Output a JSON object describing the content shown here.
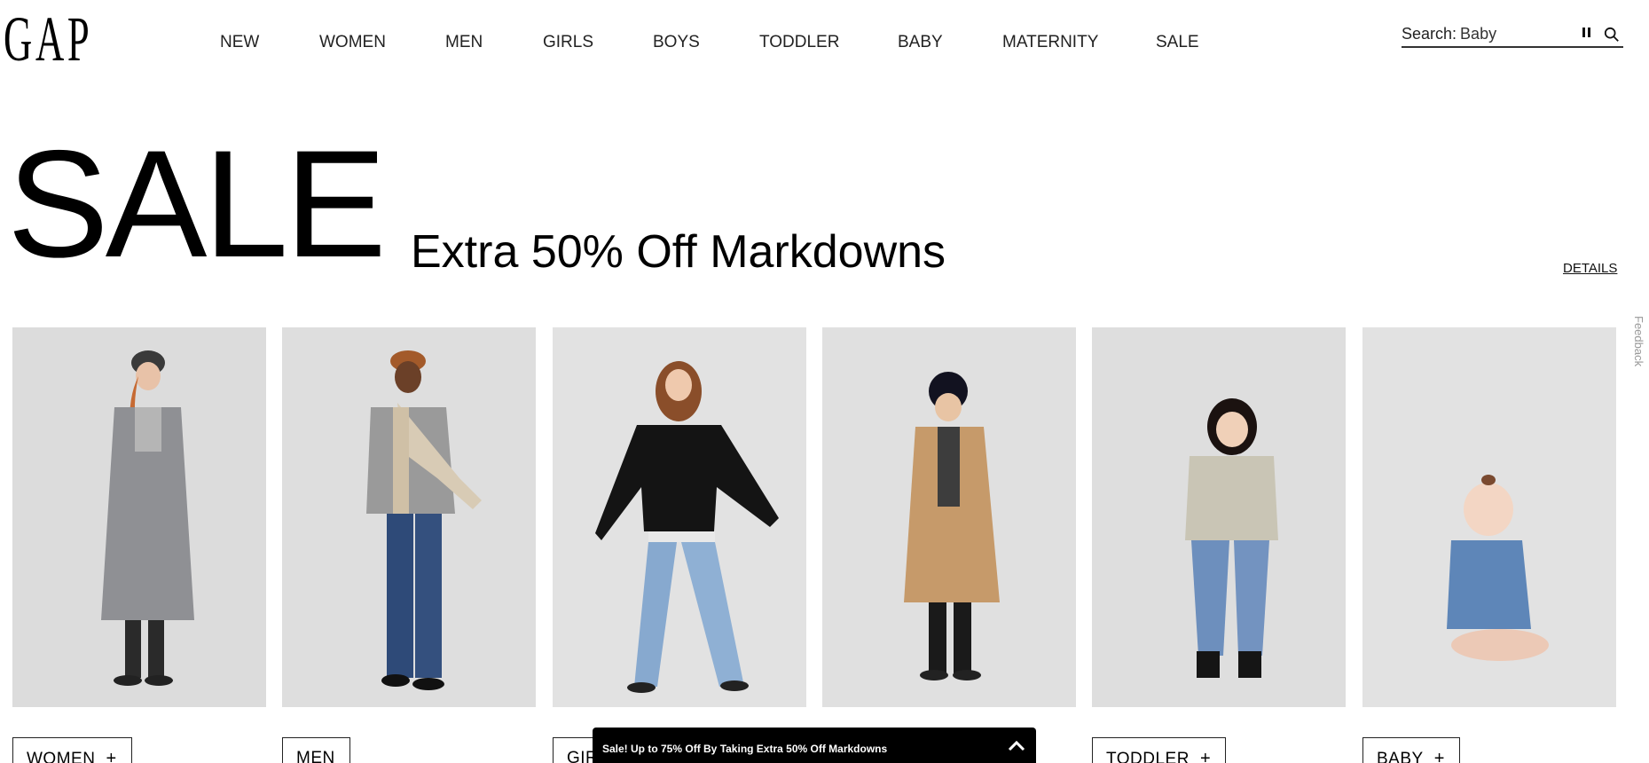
{
  "brand": {
    "logo_text": "GAP"
  },
  "nav": {
    "items": [
      {
        "label": "NEW"
      },
      {
        "label": "WOMEN"
      },
      {
        "label": "MEN"
      },
      {
        "label": "GIRLS"
      },
      {
        "label": "BOYS"
      },
      {
        "label": "TODDLER"
      },
      {
        "label": "BABY"
      },
      {
        "label": "MATERNITY"
      },
      {
        "label": "SALE"
      }
    ]
  },
  "search": {
    "label": "Search:",
    "value": "Baby"
  },
  "hero": {
    "title": "SALE",
    "subtitle": "Extra 50% Off Markdowns",
    "details_label": "DETAILS"
  },
  "feedback_label": "Feedback",
  "categories": [
    {
      "label": "WOMEN",
      "image": "woman in grey coat and cap"
    },
    {
      "label": "MEN",
      "image": "man in denim with plaid scarf"
    },
    {
      "label": "GIRLS",
      "image": "girl in black sweater and cargo jeans"
    },
    {
      "label": "BOYS",
      "image": "boy in camel coat and beanie"
    },
    {
      "label": "TODDLER",
      "image": "toddler in faux fur jacket"
    },
    {
      "label": "BABY",
      "image": "baby in denim jacket"
    }
  ],
  "promo": {
    "text": "Sale! Up to 75% Off By Taking Extra 50% Off Markdowns"
  },
  "colors": {
    "tile_bg": "#dedede",
    "promo_bg": "#000000",
    "text": "#000000"
  }
}
